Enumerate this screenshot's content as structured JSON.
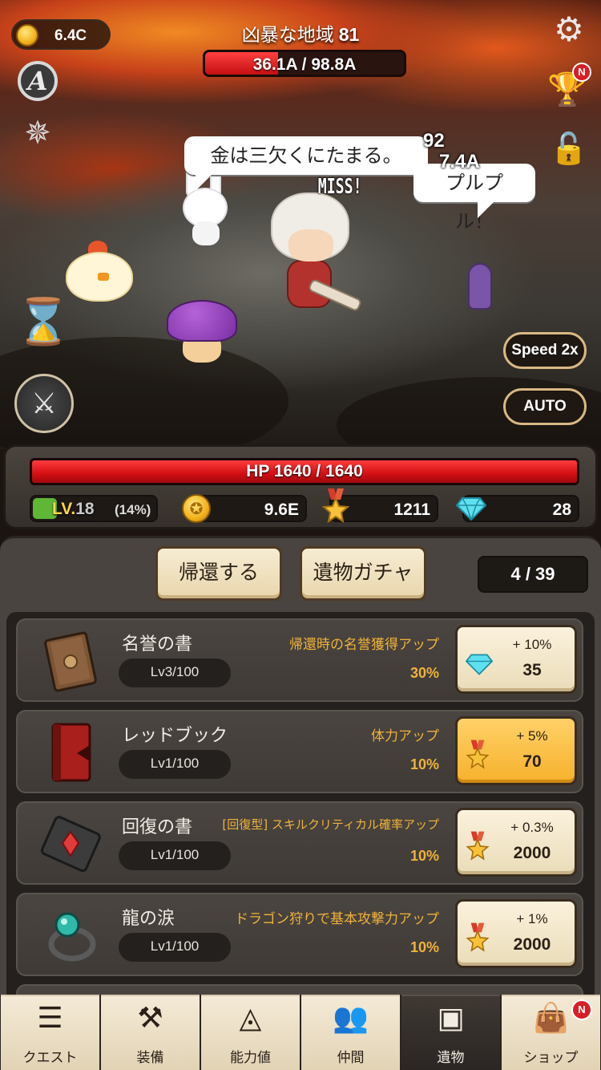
{
  "hud": {
    "coins": "6.4C",
    "area_name": "凶暴な地域",
    "area_level": "81",
    "boss_hp_text": "36.1A / 98.8A",
    "boss_hp_fraction": 0.365,
    "trophy_badge": "N"
  },
  "battle": {
    "bubble_left": "金は三欠くにたまる。",
    "bubble_right": "プルプル！",
    "damage_1": "92",
    "damage_2": "7.4A",
    "miss": "MISS!",
    "speed_label": "Speed 2x",
    "auto_label": "AUTO"
  },
  "stats": {
    "hp_text": "HP 1640 / 1640",
    "hp_fraction": 1.0,
    "lv_prefix": "LV.",
    "level": "18",
    "xp_percent": "(14%)",
    "xp_fraction": 0.14,
    "gold": "9.6E",
    "medals": "1211",
    "gems": "28"
  },
  "relic": {
    "return_label": "帰還する",
    "gacha_label": "遺物ガチャ",
    "count": "4 / 39",
    "items": [
      {
        "name": "名誉の書",
        "level": "Lv3/100",
        "desc": "帰還時の名誉獲得アップ",
        "value": "30%",
        "upgrade_pct": "+ 10%",
        "cost": "35",
        "currency": "gem",
        "icon": "brown-book-icon",
        "highlight": false
      },
      {
        "name": "レッドブック",
        "level": "Lv1/100",
        "desc": "体力アップ",
        "value": "10%",
        "upgrade_pct": "+ 5%",
        "cost": "70",
        "currency": "medal",
        "icon": "red-book-icon",
        "highlight": true
      },
      {
        "name": "回復の書",
        "level": "Lv1/100",
        "desc": "[回復型] スキルクリティカル確率アップ",
        "value": "10%",
        "upgrade_pct": "+ 0.3%",
        "cost": "2000",
        "currency": "medal",
        "icon": "gem-book-icon",
        "highlight": false
      },
      {
        "name": "龍の涙",
        "level": "Lv1/100",
        "desc": "ドラゴン狩りで基本攻撃力アップ",
        "value": "10%",
        "upgrade_pct": "+ 1%",
        "cost": "2000",
        "currency": "medal",
        "icon": "ring-icon",
        "highlight": false
      }
    ]
  },
  "nav": {
    "tabs": [
      {
        "label": "クエスト",
        "icon": "quest-list-icon"
      },
      {
        "label": "装備",
        "icon": "equipment-icon"
      },
      {
        "label": "能力値",
        "icon": "stats-triangle-icon"
      },
      {
        "label": "仲間",
        "icon": "companions-icon"
      },
      {
        "label": "遺物",
        "icon": "relic-chest-icon"
      },
      {
        "label": "ショップ",
        "icon": "shop-bag-icon"
      }
    ],
    "active_index": 4,
    "shop_badge": "N"
  },
  "colors": {
    "hp_red": "#d20f14",
    "gold_text": "#f0b23b",
    "highlight_button": "#f6b12c",
    "level_yellow": "#ffd84a"
  }
}
